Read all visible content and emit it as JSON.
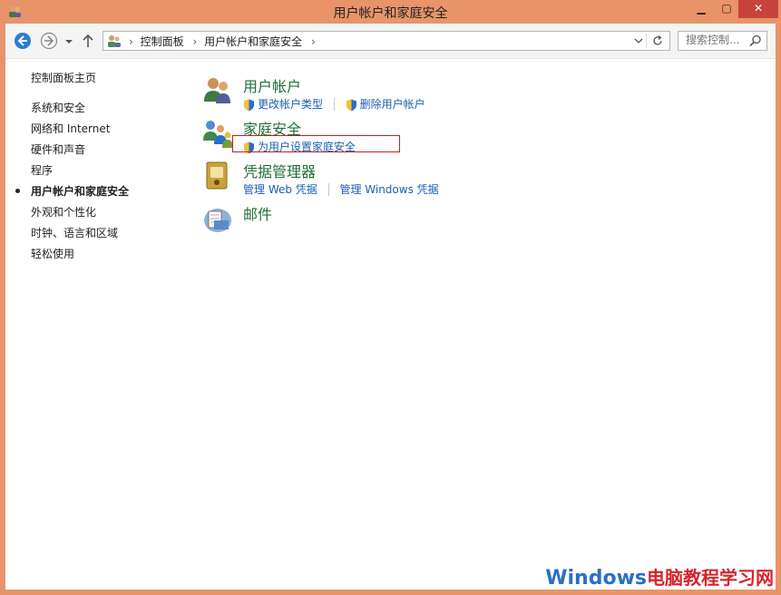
{
  "window": {
    "title": "用户帐户和家庭安全",
    "minimize": "▁",
    "maximize": "▢",
    "close": "✕"
  },
  "address": {
    "crumbs": [
      "控制面板",
      "用户帐户和家庭安全"
    ],
    "dropdown_icon": "chevron-down-icon",
    "refresh_icon": "refresh-icon"
  },
  "search": {
    "placeholder": "搜索控制..."
  },
  "sidebar": {
    "home": "控制面板主页",
    "items": [
      {
        "label": "系统和安全",
        "active": false
      },
      {
        "label": "网络和 Internet",
        "active": false
      },
      {
        "label": "硬件和声音",
        "active": false
      },
      {
        "label": "程序",
        "active": false
      },
      {
        "label": "用户帐户和家庭安全",
        "active": true
      },
      {
        "label": "外观和个性化",
        "active": false
      },
      {
        "label": "时钟、语言和区域",
        "active": false
      },
      {
        "label": "轻松使用",
        "active": false
      }
    ]
  },
  "categories": [
    {
      "title": "用户帐户",
      "links": [
        "更改帐户类型",
        "删除用户帐户"
      ]
    },
    {
      "title": "家庭安全",
      "links": [
        "为用户设置家庭安全"
      ]
    },
    {
      "title": "凭据管理器",
      "links": [
        "管理 Web 凭据",
        "管理 Windows 凭据"
      ]
    },
    {
      "title": "邮件",
      "links": []
    }
  ],
  "watermark": {
    "blue": "Windows",
    "red": "电脑教程学习网"
  },
  "colors": {
    "accent_title_bar": "#e8936a",
    "category_heading": "#1e6e3a",
    "link": "#1a5fb4",
    "highlight_box": "#c41f1f"
  }
}
